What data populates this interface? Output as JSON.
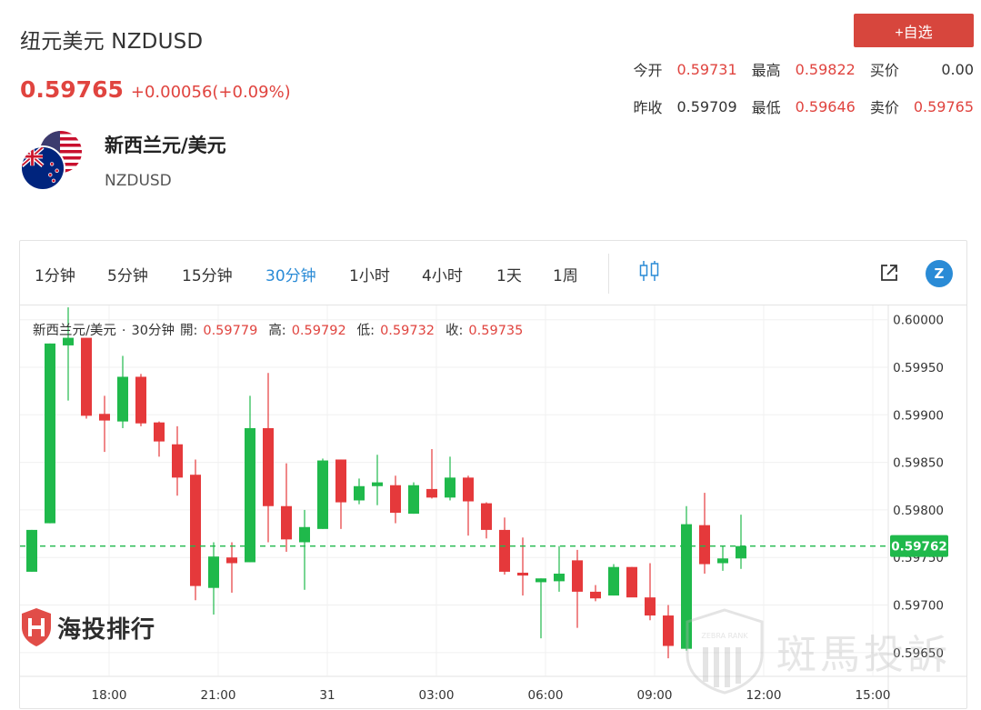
{
  "header": {
    "title": "纽元美元 NZDUSD",
    "price": "0.59765",
    "change": "+0.00056(+0.09%)",
    "favorite_label": "+自选"
  },
  "quote": [
    {
      "label": "今开",
      "value": "0.59731",
      "tone": "up"
    },
    {
      "label": "最高",
      "value": "0.59822",
      "tone": "up"
    },
    {
      "label": "买价",
      "value": "0.00",
      "tone": "neutral"
    },
    {
      "label": "昨收",
      "value": "0.59709",
      "tone": "neutral"
    },
    {
      "label": "最低",
      "value": "0.59646",
      "tone": "up"
    },
    {
      "label": "卖价",
      "value": "0.59765",
      "tone": "up"
    }
  ],
  "instrument": {
    "name": "新西兰元/美元",
    "code": "NZDUSD"
  },
  "timeframes": [
    {
      "label": "1分钟",
      "active": false
    },
    {
      "label": "5分钟",
      "active": false
    },
    {
      "label": "15分钟",
      "active": false
    },
    {
      "label": "30分钟",
      "active": true
    },
    {
      "label": "1小时",
      "active": false
    },
    {
      "label": "4小时",
      "active": false
    },
    {
      "label": "1天",
      "active": false
    },
    {
      "label": "1周",
      "active": false
    }
  ],
  "legend": {
    "symbol": "新西兰元/美元",
    "dot": "·",
    "interval": "30分钟",
    "open_label": "開:",
    "open": "0.59779",
    "high_label": "高:",
    "high": "0.59792",
    "low_label": "低:",
    "low": "0.59732",
    "close_label": "收:",
    "close": "0.59735"
  },
  "watermarks": {
    "left": "海投排行",
    "right": "斑馬投訴",
    "right_badge": "ZEBRA RANK"
  },
  "colors": {
    "up": "#1fb94b",
    "down": "#e5393b",
    "accent": "#2a8bd6",
    "price_red": "#e0443f"
  },
  "chart_data": {
    "type": "candlestick",
    "ylim": [
      0.59625,
      0.60015
    ],
    "yticks": [
      "0.60000",
      "0.59950",
      "0.59900",
      "0.59850",
      "0.59800",
      "0.59750",
      "0.59700",
      "0.59650"
    ],
    "xtick_labels": [
      "18:00",
      "21:00",
      "31",
      "03:00",
      "06:00",
      "09:00",
      "12:00",
      "15:00"
    ],
    "xtick_index": [
      5,
      11,
      17,
      23,
      29,
      35,
      41,
      47
    ],
    "current_price": "0.59762",
    "current_value": 0.59762,
    "candles": [
      {
        "o": 0.59735,
        "h": 0.59779,
        "l": 0.59735,
        "c": 0.59779
      },
      {
        "o": 0.59786,
        "h": 0.59975,
        "l": 0.59786,
        "c": 0.59975
      },
      {
        "o": 0.59973,
        "h": 0.60013,
        "l": 0.59915,
        "c": 0.59981
      },
      {
        "o": 0.59981,
        "h": 0.59981,
        "l": 0.59896,
        "c": 0.59899
      },
      {
        "o": 0.59901,
        "h": 0.5992,
        "l": 0.59861,
        "c": 0.59894
      },
      {
        "o": 0.59893,
        "h": 0.59962,
        "l": 0.59886,
        "c": 0.5994
      },
      {
        "o": 0.5994,
        "h": 0.59943,
        "l": 0.59888,
        "c": 0.59891
      },
      {
        "o": 0.59892,
        "h": 0.59893,
        "l": 0.59856,
        "c": 0.59872
      },
      {
        "o": 0.59869,
        "h": 0.59888,
        "l": 0.59815,
        "c": 0.59834
      },
      {
        "o": 0.59837,
        "h": 0.59853,
        "l": 0.59705,
        "c": 0.5972
      },
      {
        "o": 0.59718,
        "h": 0.59766,
        "l": 0.5969,
        "c": 0.59751
      },
      {
        "o": 0.5975,
        "h": 0.59766,
        "l": 0.59713,
        "c": 0.59744
      },
      {
        "o": 0.59745,
        "h": 0.5992,
        "l": 0.59745,
        "c": 0.59886
      },
      {
        "o": 0.59886,
        "h": 0.59944,
        "l": 0.59766,
        "c": 0.59804
      },
      {
        "o": 0.59804,
        "h": 0.59849,
        "l": 0.59756,
        "c": 0.59769
      },
      {
        "o": 0.59766,
        "h": 0.598,
        "l": 0.59716,
        "c": 0.59782
      },
      {
        "o": 0.5978,
        "h": 0.59854,
        "l": 0.5978,
        "c": 0.59852
      },
      {
        "o": 0.59853,
        "h": 0.59853,
        "l": 0.5978,
        "c": 0.59808
      },
      {
        "o": 0.5981,
        "h": 0.59833,
        "l": 0.59806,
        "c": 0.59825
      },
      {
        "o": 0.59825,
        "h": 0.59858,
        "l": 0.59805,
        "c": 0.59829
      },
      {
        "o": 0.59826,
        "h": 0.59836,
        "l": 0.59786,
        "c": 0.59797
      },
      {
        "o": 0.59796,
        "h": 0.59829,
        "l": 0.59796,
        "c": 0.59826
      },
      {
        "o": 0.59822,
        "h": 0.59864,
        "l": 0.59812,
        "c": 0.59813
      },
      {
        "o": 0.59813,
        "h": 0.59856,
        "l": 0.5981,
        "c": 0.59834
      },
      {
        "o": 0.59834,
        "h": 0.59836,
        "l": 0.59773,
        "c": 0.59809
      },
      {
        "o": 0.59807,
        "h": 0.59808,
        "l": 0.5977,
        "c": 0.59779
      },
      {
        "o": 0.59779,
        "h": 0.59792,
        "l": 0.59732,
        "c": 0.59735
      },
      {
        "o": 0.59734,
        "h": 0.59771,
        "l": 0.5971,
        "c": 0.59731
      },
      {
        "o": 0.59724,
        "h": 0.59728,
        "l": 0.59665,
        "c": 0.59728
      },
      {
        "o": 0.59725,
        "h": 0.59762,
        "l": 0.59714,
        "c": 0.59733
      },
      {
        "o": 0.59747,
        "h": 0.59758,
        "l": 0.59676,
        "c": 0.59714
      },
      {
        "o": 0.59714,
        "h": 0.59721,
        "l": 0.59704,
        "c": 0.59707
      },
      {
        "o": 0.5971,
        "h": 0.59743,
        "l": 0.5971,
        "c": 0.5974
      },
      {
        "o": 0.5974,
        "h": 0.5974,
        "l": 0.59712,
        "c": 0.59708
      },
      {
        "o": 0.59708,
        "h": 0.59744,
        "l": 0.59684,
        "c": 0.59689
      },
      {
        "o": 0.59689,
        "h": 0.597,
        "l": 0.59644,
        "c": 0.59657
      },
      {
        "o": 0.59654,
        "h": 0.59804,
        "l": 0.59652,
        "c": 0.59785
      },
      {
        "o": 0.59784,
        "h": 0.59818,
        "l": 0.59733,
        "c": 0.59743
      },
      {
        "o": 0.59744,
        "h": 0.59762,
        "l": 0.59736,
        "c": 0.59749
      },
      {
        "o": 0.59749,
        "h": 0.59795,
        "l": 0.59738,
        "c": 0.59762
      }
    ]
  }
}
